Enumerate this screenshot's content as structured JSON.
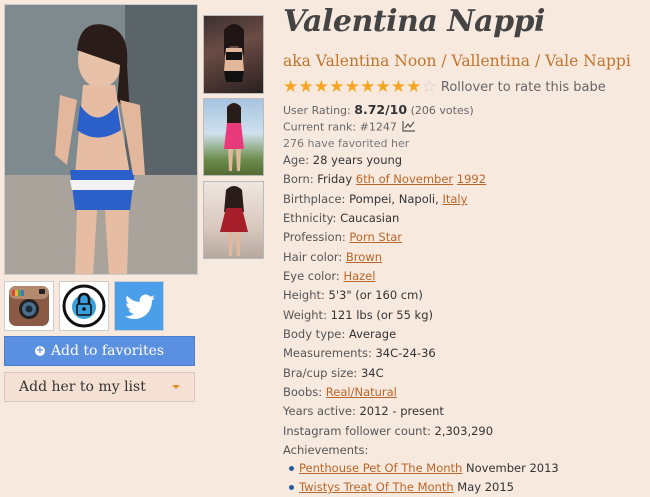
{
  "profile": {
    "name": "Valentina Nappi",
    "aka": "aka Valentina Noon / Vallentina / Vale Nappi",
    "rollover_text": "Rollover to rate this babe",
    "rating_stars": {
      "value": 8.72,
      "max": 10
    },
    "user_rating_label": "User Rating:",
    "user_rating_value": "8.72/10",
    "user_rating_votes": "(206 votes)",
    "current_rank": "Current rank: #1247",
    "favorited": "276 have favorited her"
  },
  "buttons": {
    "add_favorites": "Add to favorites",
    "add_list": "Add her to my list"
  },
  "social": {
    "instagram": "instagram-icon",
    "lock": "lock-icon",
    "twitter": "twitter-icon"
  },
  "details": {
    "age_label": "Age:",
    "age_value": "28 years young",
    "born_label": "Born:",
    "born_day": "Friday",
    "born_date": "6th of November",
    "born_year": "1992",
    "birthplace_label": "Birthplace:",
    "birthplace_value": "Pompei, Napoli,",
    "birthplace_country": "Italy",
    "ethnicity_label": "Ethnicity:",
    "ethnicity_value": "Caucasian",
    "profession_label": "Profession:",
    "profession_value": "Porn Star",
    "hair_label": "Hair color:",
    "hair_value": "Brown",
    "eye_label": "Eye color:",
    "eye_value": "Hazel",
    "height_label": "Height:",
    "height_value": "5'3\" (or 160 cm)",
    "weight_label": "Weight:",
    "weight_value": "121 lbs (or 55 kg)",
    "body_label": "Body type:",
    "body_value": "Average",
    "measurements_label": "Measurements:",
    "measurements_value": "34C-24-36",
    "bra_label": "Bra/cup size:",
    "bra_value": "34C",
    "boobs_label": "Boobs:",
    "boobs_value": "Real/Natural",
    "years_label": "Years active:",
    "years_value": "2012 - present",
    "instagram_label": "Instagram follower count:",
    "instagram_value": "2,303,290",
    "achievements_label": "Achievements:"
  },
  "achievements": [
    {
      "title": "Penthouse Pet Of The Month",
      "date": "November 2013"
    },
    {
      "title": "Twistys Treat Of The Month",
      "date": "May 2015"
    }
  ],
  "colors": {
    "background": "#f8e9df",
    "link": "#b8672a",
    "aka": "#c0742c",
    "star": "#f5a623",
    "favorites_button": "#5b8fe0",
    "twitter": "#4a9fe8"
  }
}
